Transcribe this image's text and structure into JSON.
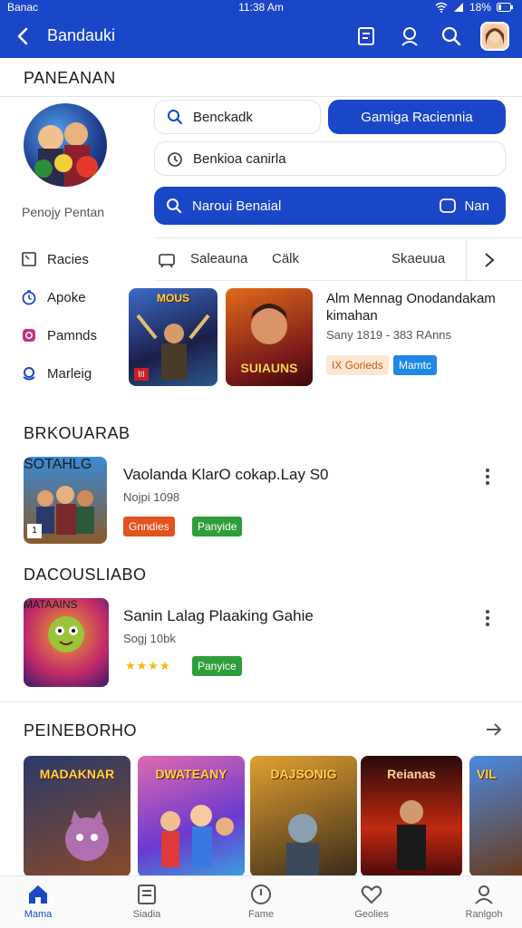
{
  "status_bar": {
    "carrier": "Banac",
    "time": "11:38 Am",
    "battery": "18%"
  },
  "app_bar": {
    "title": "Bandauki"
  },
  "section_1": {
    "heading": "PANEANAN"
  },
  "profile": {
    "name": "Penojy Pentan"
  },
  "search": {
    "pill1": "Benckadk",
    "pill1_button": "Gamiga Raciennia",
    "pill2": "Benkioa canirla",
    "pill3": "Naroui Benaial",
    "pill3_right": "Nan"
  },
  "tabs": {
    "items": [
      "Saleauna",
      "Cälk",
      "Skaeuua"
    ]
  },
  "side_menu": {
    "items": [
      "Racies",
      "Apoke",
      "Pamnds",
      "Marleig"
    ]
  },
  "featured": {
    "covers": [
      {
        "title": "MOUS",
        "bottom": "III"
      },
      {
        "title": "SUIAUNS",
        "bottom": ""
      }
    ],
    "title": "Alm Mennag Onodandakam kimahan",
    "price": "Sany 1819 - 383 RAnns",
    "tags": [
      "IX Gorieds",
      "Mamtc"
    ]
  },
  "section_2": {
    "heading": "BRKOUARAB",
    "item": {
      "cover": "SOTAHLG",
      "title": "Vaolanda KlarO cokap.Lay S0",
      "subtitle": "Nojpi 1098",
      "tags": [
        "Gnndies",
        "Panyide"
      ]
    }
  },
  "section_3": {
    "heading": "DACOUSLIABO",
    "item": {
      "cover": "MATAAINS",
      "title": "Sanin Lalag Plaaking Gahie",
      "subtitle": "Sogj 10bk",
      "rating": "★★★★",
      "rating_value": 4,
      "tag": "Panyice"
    }
  },
  "section_4": {
    "heading": "PEINEBORHO",
    "posters": [
      "MADAKNAR",
      "DWATEANY",
      "DAJSONIG",
      "Reianas",
      "VIL"
    ]
  },
  "bottom_nav": {
    "items": [
      "Mama",
      "Siadia",
      "Fame",
      "Geolies",
      "Ranlgoh"
    ],
    "active_index": 0
  },
  "colors": {
    "brand": "#1a47c7",
    "orange_tag": "#e2531f",
    "green_tag": "#2e9e3a",
    "blue_tag": "#1e88e5",
    "star": "#f5b800"
  }
}
